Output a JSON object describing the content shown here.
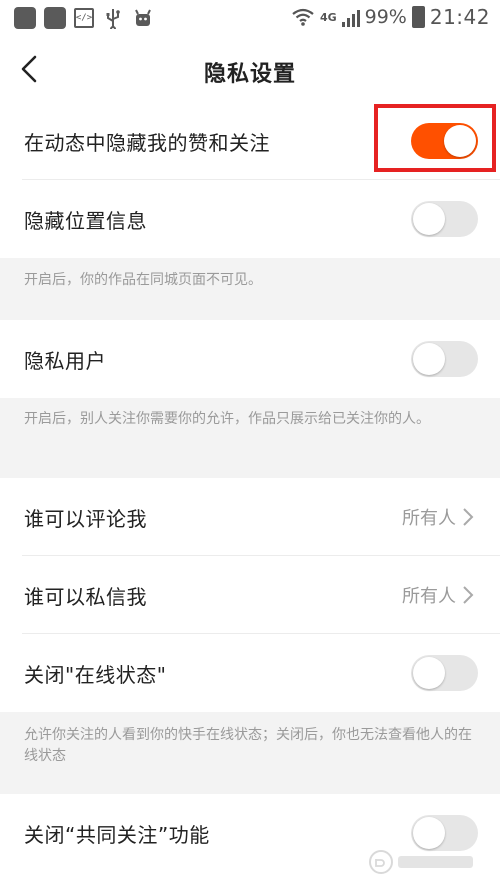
{
  "status_bar": {
    "network": "4G",
    "battery": "99%",
    "time": "21:42"
  },
  "header": {
    "title": "隐私设置"
  },
  "settings": {
    "hide_likes": {
      "label": "在动态中隐藏我的赞和关注",
      "enabled": true
    },
    "hide_location": {
      "label": "隐藏位置信息",
      "enabled": false,
      "note": "开启后，你的作品在同城页面不可见。"
    },
    "private_user": {
      "label": "隐私用户",
      "enabled": false,
      "note": "开启后，别人关注你需要你的允许，作品只展示给已关注你的人。"
    },
    "who_comment": {
      "label": "谁可以评论我",
      "value": "所有人"
    },
    "who_message": {
      "label": "谁可以私信我",
      "value": "所有人"
    },
    "online_status": {
      "label": "关闭\"在线状态\"",
      "enabled": false,
      "note": "允许你关注的人看到你的快手在线状态；关闭后，你也无法查看他人的在线状态"
    },
    "mutual_follow": {
      "label": "关闭“共同关注”功能",
      "enabled": false
    }
  },
  "colors": {
    "accent": "#ff5000",
    "highlight": "#e62222",
    "note_bg": "#f3f3f3"
  }
}
